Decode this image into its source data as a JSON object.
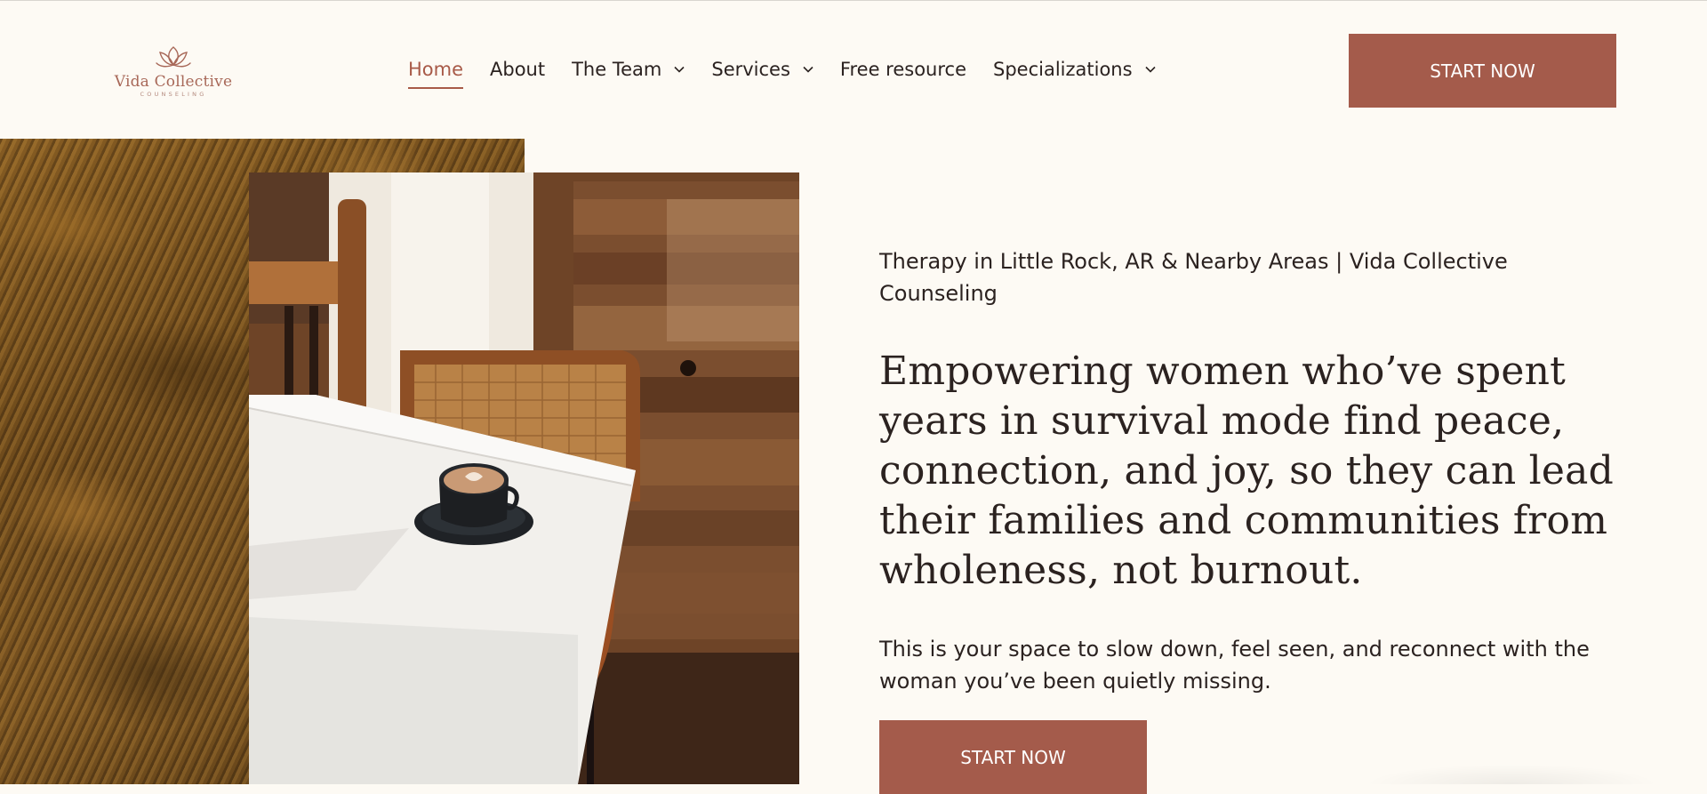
{
  "brand": {
    "name": "Vida Collective",
    "subtitle": "COUNSELING",
    "logo_icon": "lotus-icon",
    "accent_color": "#a45b4b"
  },
  "nav": {
    "items": [
      {
        "label": "Home",
        "active": true,
        "has_dropdown": false
      },
      {
        "label": "About",
        "active": false,
        "has_dropdown": false
      },
      {
        "label": "The Team",
        "active": false,
        "has_dropdown": true
      },
      {
        "label": "Services",
        "active": false,
        "has_dropdown": true
      },
      {
        "label": "Free resource",
        "active": false,
        "has_dropdown": false
      },
      {
        "label": "Specializations",
        "active": false,
        "has_dropdown": true
      }
    ],
    "cta_label": "START NOW"
  },
  "hero": {
    "tagline": "Therapy in Little Rock, AR & Nearby Areas | Vida Collective Counseling",
    "headline": "Empowering women who’ve spent years in survival mode find peace, connection, and joy, so they can lead their families and communities from wholeness, not burnout.",
    "body": "This is your space to slow down, feel seen, and reconnect with the woman you’ve been quietly missing.",
    "cta_label": "START NOW"
  }
}
